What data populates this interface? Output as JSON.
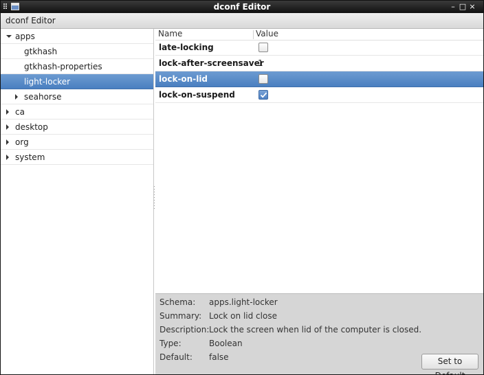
{
  "window": {
    "title": "dconf Editor",
    "controls": {
      "minimize": "–",
      "maximize": "□",
      "close": "×"
    }
  },
  "header": {
    "app_title": "dconf Editor"
  },
  "tree": {
    "items": [
      {
        "label": "apps",
        "level": 0,
        "state": "expanded",
        "selected": false
      },
      {
        "label": "gtkhash",
        "level": 1,
        "state": "leaf",
        "selected": false
      },
      {
        "label": "gtkhash-properties",
        "level": 1,
        "state": "leaf",
        "selected": false
      },
      {
        "label": "light-locker",
        "level": 1,
        "state": "leaf",
        "selected": true
      },
      {
        "label": "seahorse",
        "level": 1,
        "state": "collapsed",
        "selected": false
      },
      {
        "label": "ca",
        "level": 0,
        "state": "collapsed",
        "selected": false
      },
      {
        "label": "desktop",
        "level": 0,
        "state": "collapsed",
        "selected": false
      },
      {
        "label": "org",
        "level": 0,
        "state": "collapsed",
        "selected": false
      },
      {
        "label": "system",
        "level": 0,
        "state": "collapsed",
        "selected": false
      }
    ]
  },
  "keys": {
    "columns": {
      "name": "Name",
      "value": "Value"
    },
    "rows": [
      {
        "name": "late-locking",
        "type": "bool",
        "value": false,
        "selected": false
      },
      {
        "name": "lock-after-screensaver",
        "type": "int",
        "value": "1",
        "selected": false
      },
      {
        "name": "lock-on-lid",
        "type": "bool",
        "value": false,
        "selected": true
      },
      {
        "name": "lock-on-suspend",
        "type": "bool",
        "value": true,
        "selected": false
      }
    ]
  },
  "details": {
    "schema_label": "Schema:",
    "schema": "apps.light-locker",
    "summary_label": "Summary:",
    "summary": "Lock on lid close",
    "description_label": "Description:",
    "description": "Lock the screen when lid of the computer is closed.",
    "type_label": "Type:",
    "type": "Boolean",
    "default_label": "Default:",
    "default": "false",
    "set_default_label": "Set to Default"
  },
  "colors": {
    "selection": "#4a7fc0",
    "titlebar": "#111111",
    "details_bg": "#d6d6d6"
  }
}
